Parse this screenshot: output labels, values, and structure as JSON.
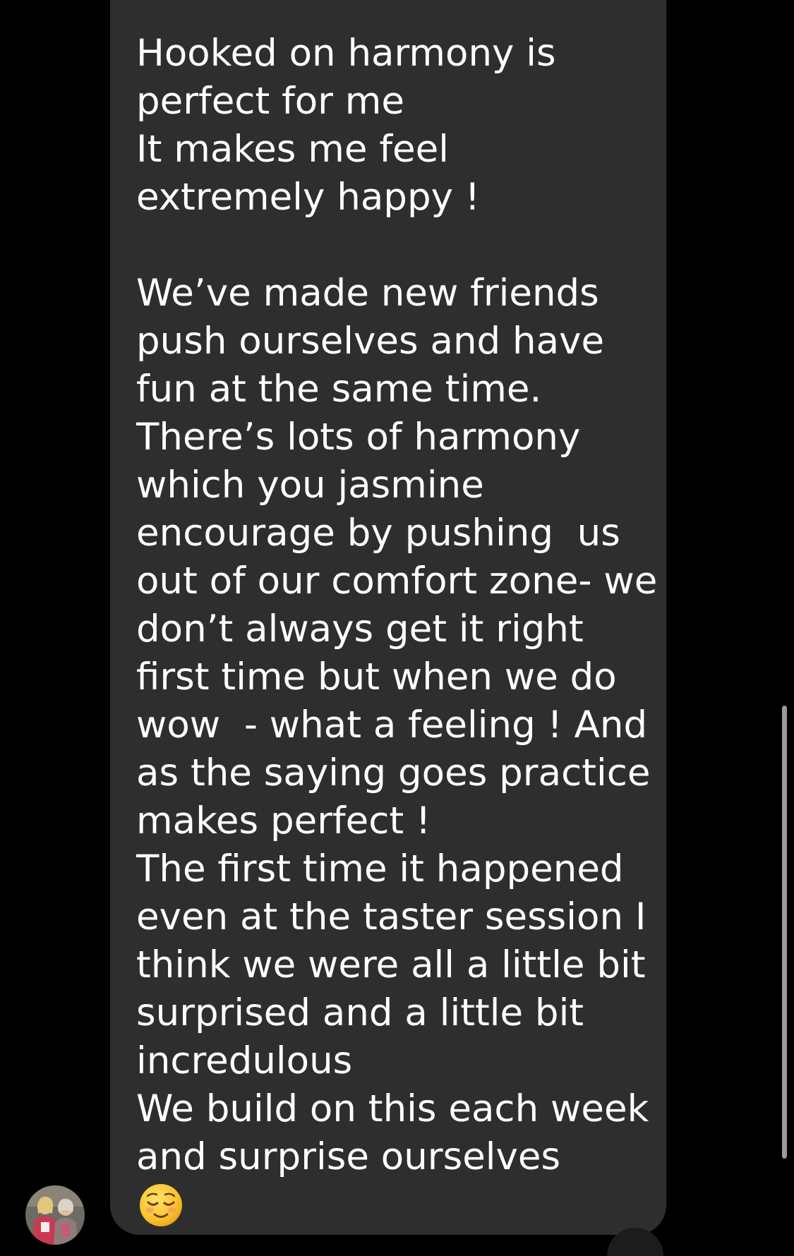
{
  "message": {
    "lines": [
      "Hooked on harmony is",
      "perfect for me",
      "It makes me feel",
      "extremely happy !",
      "",
      "We’ve made new friends",
      "push ourselves and have",
      "fun at the same time.",
      "There’s lots of harmony",
      "which you jasmine",
      "encourage by pushing  us",
      "out of our comfort zone- we",
      "don’t always get it right",
      "first time but when we do",
      "wow  - what a feeling ! And",
      "as the saying goes practice",
      "makes perfect !",
      "The first time it happened",
      "even at the taster session I",
      "think we were all a little bit",
      "surprised and a little bit",
      "incredulous",
      "We build on this each week",
      "and surprise ourselves"
    ],
    "emoji": "relieved-face-emoji"
  },
  "avatar": {
    "icon": "sender-avatar-photo"
  },
  "colors": {
    "background": "#000000",
    "bubble": "#2e2e2e",
    "text": "#ffffff"
  }
}
